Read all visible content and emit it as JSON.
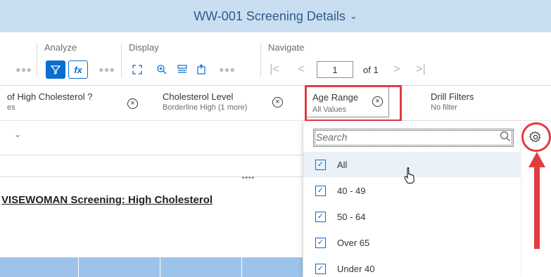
{
  "title": {
    "text": "WW-001 Screening Details",
    "chevron": "chevron-down-icon"
  },
  "toolbar": {
    "groups": {
      "analyze": "Analyze",
      "display": "Display",
      "navigate": "Navigate"
    },
    "more": "∘∘∘",
    "fx_label": "fx",
    "page_value": "1",
    "of_text": "of 1"
  },
  "filters": [
    {
      "title": "of High Cholesterol ?",
      "subtitle": "es"
    },
    {
      "title": "Cholesterol Level",
      "subtitle": "Borderline High (1 more)"
    },
    {
      "title": "Age Range",
      "subtitle": "All Values"
    },
    {
      "title": "Drill Filters",
      "subtitle": "No filter"
    }
  ],
  "report": {
    "heading": "VISEWOMAN Screening: High Cholesterol",
    "resize": "••••"
  },
  "dropdown": {
    "search_placeholder": "Search",
    "options": [
      {
        "label": "All",
        "checked": true,
        "highlighted": true
      },
      {
        "label": "40 - 49",
        "checked": true
      },
      {
        "label": "50 - 64",
        "checked": true
      },
      {
        "label": "Over 65",
        "checked": true
      },
      {
        "label": "Under 40",
        "checked": true
      }
    ]
  },
  "colors": {
    "title_bar": "#c9dff1",
    "accent": "#0a6ed1",
    "annotation_red": "#e03c41",
    "row_blue": "#9dc3ea"
  }
}
